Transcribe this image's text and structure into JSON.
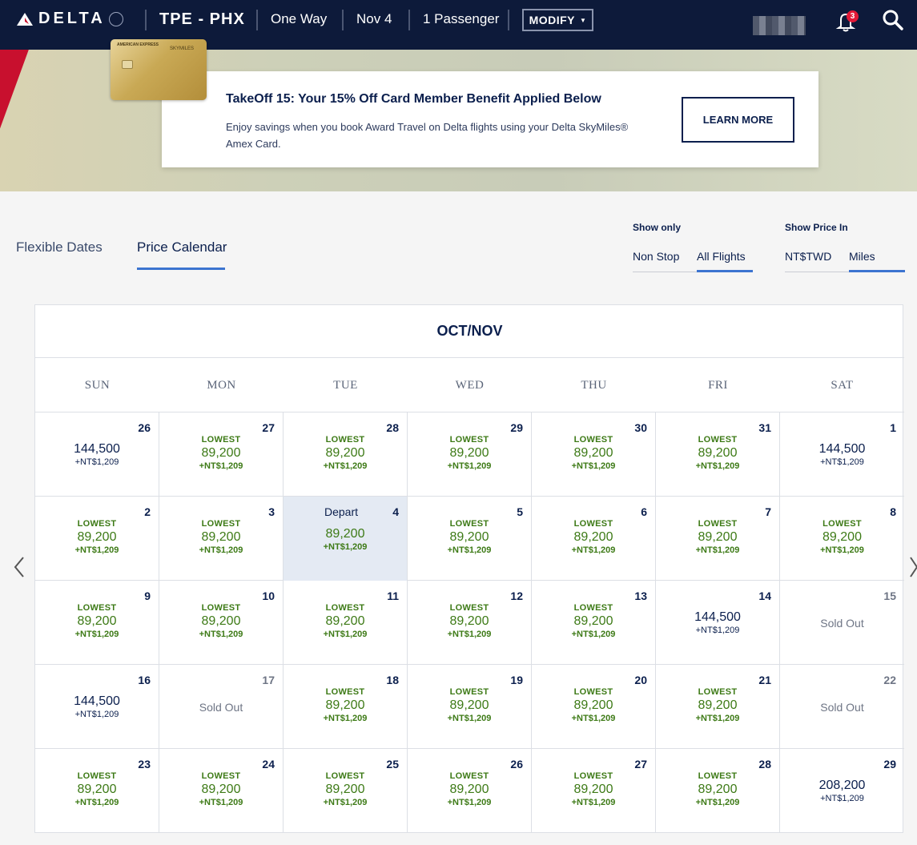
{
  "header": {
    "logo_text": "DELTA",
    "route": "TPE - PHX",
    "trip_type": "One Way",
    "date": "Nov 4",
    "passengers": "1 Passenger",
    "modify_label": "MODIFY",
    "notification_count": "3"
  },
  "promo": {
    "title": "TakeOff 15: Your 15% Off Card Member Benefit Applied Below",
    "description": "Enjoy savings when you book Award Travel on Delta flights using your Delta SkyMiles® Amex Card.",
    "button_label": "LEARN MORE",
    "card_brand": "AMERICAN EXPRESS",
    "card_product": "SKYMILES"
  },
  "tabs": [
    "Flexible Dates",
    "Price Calendar"
  ],
  "filters": {
    "show_only_label": "Show only",
    "show_only_options": [
      "Non Stop",
      "All Flights"
    ],
    "price_in_label": "Show Price In",
    "price_in_options": [
      "NT$TWD",
      "Miles"
    ]
  },
  "calendar": {
    "month": "OCT/NOV",
    "weekdays": [
      "SUN",
      "MON",
      "TUE",
      "WED",
      "THU",
      "FRI",
      "SAT"
    ],
    "depart_label": "Depart",
    "lowest_label": "LOWEST",
    "sold_out_label": "Sold Out",
    "weeks": [
      [
        {
          "day": "26",
          "miles": "144,500",
          "tax": "+NT$1,209",
          "lowest": false
        },
        {
          "day": "27",
          "miles": "89,200",
          "tax": "+NT$1,209",
          "lowest": true
        },
        {
          "day": "28",
          "miles": "89,200",
          "tax": "+NT$1,209",
          "lowest": true
        },
        {
          "day": "29",
          "miles": "89,200",
          "tax": "+NT$1,209",
          "lowest": true
        },
        {
          "day": "30",
          "miles": "89,200",
          "tax": "+NT$1,209",
          "lowest": true
        },
        {
          "day": "31",
          "miles": "89,200",
          "tax": "+NT$1,209",
          "lowest": true
        },
        {
          "day": "1",
          "miles": "144,500",
          "tax": "+NT$1,209",
          "lowest": false
        }
      ],
      [
        {
          "day": "2",
          "miles": "89,200",
          "tax": "+NT$1,209",
          "lowest": true
        },
        {
          "day": "3",
          "miles": "89,200",
          "tax": "+NT$1,209",
          "lowest": true
        },
        {
          "day": "4",
          "miles": "89,200",
          "tax": "+NT$1,209",
          "lowest": true,
          "selected": true
        },
        {
          "day": "5",
          "miles": "89,200",
          "tax": "+NT$1,209",
          "lowest": true
        },
        {
          "day": "6",
          "miles": "89,200",
          "tax": "+NT$1,209",
          "lowest": true
        },
        {
          "day": "7",
          "miles": "89,200",
          "tax": "+NT$1,209",
          "lowest": true
        },
        {
          "day": "8",
          "miles": "89,200",
          "tax": "+NT$1,209",
          "lowest": true
        }
      ],
      [
        {
          "day": "9",
          "miles": "89,200",
          "tax": "+NT$1,209",
          "lowest": true
        },
        {
          "day": "10",
          "miles": "89,200",
          "tax": "+NT$1,209",
          "lowest": true
        },
        {
          "day": "11",
          "miles": "89,200",
          "tax": "+NT$1,209",
          "lowest": true
        },
        {
          "day": "12",
          "miles": "89,200",
          "tax": "+NT$1,209",
          "lowest": true
        },
        {
          "day": "13",
          "miles": "89,200",
          "tax": "+NT$1,209",
          "lowest": true
        },
        {
          "day": "14",
          "miles": "144,500",
          "tax": "+NT$1,209",
          "lowest": false
        },
        {
          "day": "15",
          "sold_out": true
        }
      ],
      [
        {
          "day": "16",
          "miles": "144,500",
          "tax": "+NT$1,209",
          "lowest": false
        },
        {
          "day": "17",
          "sold_out": true
        },
        {
          "day": "18",
          "miles": "89,200",
          "tax": "+NT$1,209",
          "lowest": true
        },
        {
          "day": "19",
          "miles": "89,200",
          "tax": "+NT$1,209",
          "lowest": true
        },
        {
          "day": "20",
          "miles": "89,200",
          "tax": "+NT$1,209",
          "lowest": true
        },
        {
          "day": "21",
          "miles": "89,200",
          "tax": "+NT$1,209",
          "lowest": true
        },
        {
          "day": "22",
          "sold_out": true
        }
      ],
      [
        {
          "day": "23",
          "miles": "89,200",
          "tax": "+NT$1,209",
          "lowest": true
        },
        {
          "day": "24",
          "miles": "89,200",
          "tax": "+NT$1,209",
          "lowest": true
        },
        {
          "day": "25",
          "miles": "89,200",
          "tax": "+NT$1,209",
          "lowest": true
        },
        {
          "day": "26",
          "miles": "89,200",
          "tax": "+NT$1,209",
          "lowest": true
        },
        {
          "day": "27",
          "miles": "89,200",
          "tax": "+NT$1,209",
          "lowest": true
        },
        {
          "day": "28",
          "miles": "89,200",
          "tax": "+NT$1,209",
          "lowest": true
        },
        {
          "day": "29",
          "miles": "208,200",
          "tax": "+NT$1,209",
          "lowest": false
        }
      ]
    ]
  },
  "colors": {
    "header_bg": "#0d1a3a",
    "lowest_green": "#3d7a16",
    "accent_blue": "#3c74d0",
    "navy_text": "#0b1f4d",
    "selected_cell": "#e4eaf3",
    "badge_red": "#e31837"
  },
  "icons": [
    "delta-widget-icon",
    "bell-icon",
    "search-icon",
    "chevron-left-icon",
    "chevron-right-icon",
    "caret-down-icon"
  ]
}
